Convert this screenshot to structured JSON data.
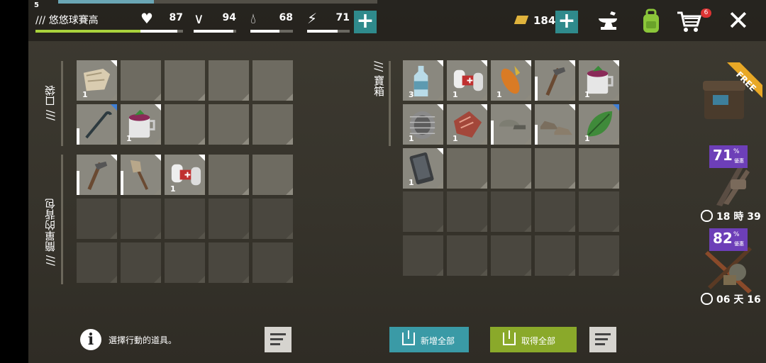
{
  "player": {
    "level": "5",
    "name": "/// 悠悠球賽高",
    "xp_fill": 0.3,
    "name_bar_fill": 0.85
  },
  "stats": [
    {
      "icon": "heart-icon",
      "value": "87",
      "fill": 0.87
    },
    {
      "icon": "stomach-icon",
      "value": "94",
      "fill": 0.94
    },
    {
      "icon": "water-drop-icon",
      "value": "68",
      "fill": 0.68
    },
    {
      "icon": "energy-icon",
      "value": "71",
      "fill": 0.71
    }
  ],
  "currency": {
    "gold": "184"
  },
  "cart_badge": "6",
  "pockets": {
    "label": "/// 口袋"
  },
  "backpack": {
    "label": "/// 簡單的背包"
  },
  "chest": {
    "label": "/// 寶箱"
  },
  "pocket_items": [
    {
      "icon": "cloth-rags-icon",
      "count": "1",
      "corner": "white"
    },
    null,
    null,
    null,
    null,
    {
      "icon": "crowbar-icon",
      "count": "",
      "corner": "blue",
      "durability": 0.4
    },
    {
      "icon": "cup-soup-icon",
      "count": "1",
      "corner": "white"
    },
    null,
    null,
    null
  ],
  "backpack_items": [
    {
      "icon": "hoe-icon",
      "count": "",
      "corner": "white",
      "durability": 0.6
    },
    {
      "icon": "broom-icon",
      "count": "",
      "corner": "white",
      "durability": 0.6
    },
    {
      "icon": "bandages-icon",
      "count": "1",
      "corner": "white"
    },
    null,
    null
  ],
  "chest_items": [
    {
      "icon": "water-bottle-icon",
      "count": "3",
      "corner": "white"
    },
    {
      "icon": "bandages-icon",
      "count": "1",
      "corner": "white"
    },
    {
      "icon": "corn-icon",
      "count": "1",
      "corner": "white"
    },
    {
      "icon": "hoe-icon",
      "count": "",
      "corner": "white",
      "durability": 0.6
    },
    {
      "icon": "cup-soup-icon",
      "count": "1",
      "corner": "white"
    },
    {
      "icon": "wire-coil-icon",
      "count": "1",
      "corner": "white"
    },
    {
      "icon": "raw-meat-icon",
      "count": "1",
      "corner": "white"
    },
    {
      "icon": "cap-icon",
      "count": "",
      "corner": "white",
      "durability": 0.6
    },
    {
      "icon": "shoes-icon",
      "count": "",
      "corner": "white",
      "durability": 0.5
    },
    {
      "icon": "leaf-icon",
      "count": "1",
      "corner": "blue"
    },
    {
      "icon": "phone-icon",
      "count": "1",
      "corner": "white"
    },
    null,
    null,
    null,
    null
  ],
  "bottom": {
    "hint": "選擇行動的道具。",
    "add_all": "新增全部",
    "take_all": "取得全部"
  },
  "offers": {
    "free_label": "FREE",
    "offer1": {
      "percent": "71",
      "pct_sign": "%",
      "tag": "優惠",
      "timer": "18 時 39"
    },
    "offer2": {
      "percent": "82",
      "pct_sign": "%",
      "tag": "優惠",
      "timer": "06 天 16"
    }
  },
  "colors": {
    "accent_teal": "#3a9aa6",
    "accent_green": "#8aa92a",
    "offer_purple": "#6d3fb8"
  }
}
